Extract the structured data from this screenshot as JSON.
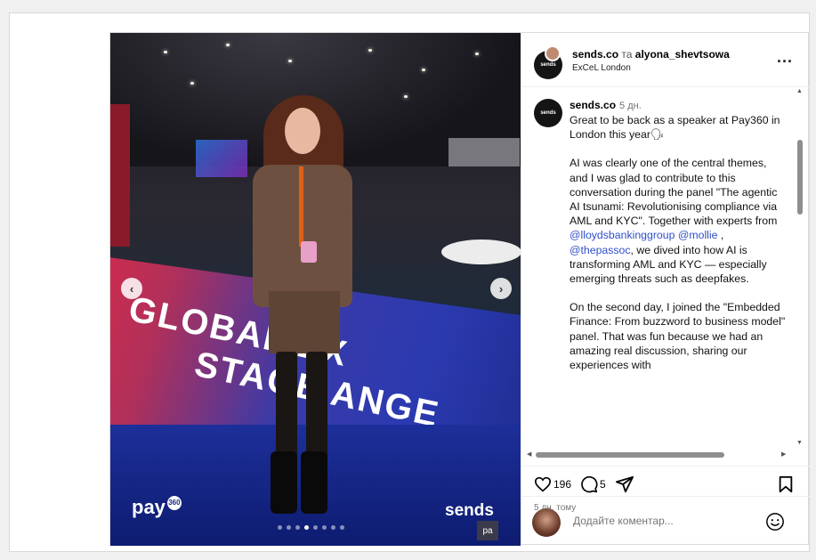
{
  "header": {
    "user1": "sends.co",
    "separator": "та",
    "user2": "alyona_shevtsowa",
    "location": "ExCeL London",
    "avatar_text": "sends",
    "more_label": "..."
  },
  "photo": {
    "banner_line1": "GLOBAL EX",
    "banner_line2": "STAGE ANGE",
    "brand_left": "pay",
    "brand_left_sup": "360",
    "brand_right": "sends",
    "brand_right_small": "pa",
    "slide_dots": 8,
    "active_slide": 3
  },
  "caption": {
    "author": "sends.co",
    "time": "5 дн.",
    "p1": "Great to be back as a speaker at Pay360 in London this year🗣",
    "p2_part1": "AI was clearly one of the central themes, and I was glad to contribute to this conversation during the panel \"The agentic AI tsunami: Revolutionising compliance via AML and KYC\". Together with experts from ",
    "mention1": "@lloydsbankinggroup",
    "mention2": "@mollie",
    "comma": " ,",
    "mention3": "@thepassoc",
    "p2_part2": ", we dived into how AI is transforming AML and KYC — especially emerging threats such as deepfakes.",
    "p3": "On the second day, I joined the \"Embedded Finance: From buzzword to business model\" panel. That was fun because we had an amazing real discussion, sharing our experiences with"
  },
  "actions": {
    "likes": "196",
    "comments": "5",
    "ago": "5 дн. тому"
  },
  "comment": {
    "placeholder": "Додайте коментар..."
  }
}
